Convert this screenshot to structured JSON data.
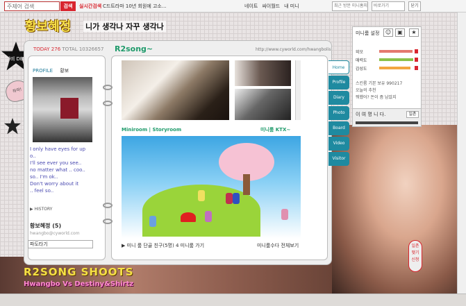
{
  "topbar": {
    "search_placeholder": "주제어 검색",
    "search_button": "검색",
    "hot_label": "실시간검색",
    "news": "C드트라마 10년 회원에 고소...",
    "links": [
      "네이트",
      "싸이월드",
      "내 미니"
    ],
    "select1": "최근 방문 미니홈피",
    "select2": "바로가기",
    "close": "닫기"
  },
  "deco": {
    "title": "황보혜정",
    "slogan": "니가 생각나 자꾸 생각나",
    "star_text": "다비 DET",
    "heart_text": "하하!",
    "bottom_brand": "R2SONG SHOOTS",
    "bottom_sub": "Hwangbo Vs Destiny&Shirtz"
  },
  "home": {
    "today_label": "TODAY 276",
    "total_label": "TOTAL 10326657",
    "title": "R2song~",
    "url": "http://www.cyworld.com/hwangbolis"
  },
  "profile": {
    "head": "PROFILE",
    "name": "황보",
    "lines": [
      "I only have eyes for up",
      "o..",
      "I'll see ever you see..",
      "no matter what .. coo..",
      "",
      "so.. I'm ok..",
      "Don't worry about it",
      ".. feel so.."
    ],
    "history": "▶ HISTORY",
    "friends": "황보혜정 (5)",
    "url": "hwangbo@cyworld.com",
    "select": "파도타기"
  },
  "miniroom": {
    "label": "Miniroom | Storyroom",
    "right_label": "미니룸 KTX~",
    "bottom_left": "▶ 미니 룸 단골 친구(5명) 4 미니룸 가기",
    "bottom_right": "미니룸수다 전체보기"
  },
  "side_tabs": [
    "Home",
    "Profile",
    "Diary",
    "Photo",
    "Board",
    "Video",
    "Visitor"
  ],
  "info": {
    "title": "미니룸 설정",
    "stats": [
      {
        "label": "외모",
        "color": "#e4796f",
        "value": 90
      },
      {
        "label": "매력도",
        "color": "#8bc14a",
        "value": 92
      },
      {
        "label": "감성도",
        "color": "#f2a640",
        "value": 85
      }
    ],
    "lines": [
      "스킨룸 기본 보유 990217",
      "오늘의 추천",
      "뭐했어? 돈이 좀 남았지"
    ],
    "wave_text": "이 여 명 니 다.",
    "wave_button": "일촌"
  },
  "pin": {
    "text": "일촌 맺기 신청"
  }
}
